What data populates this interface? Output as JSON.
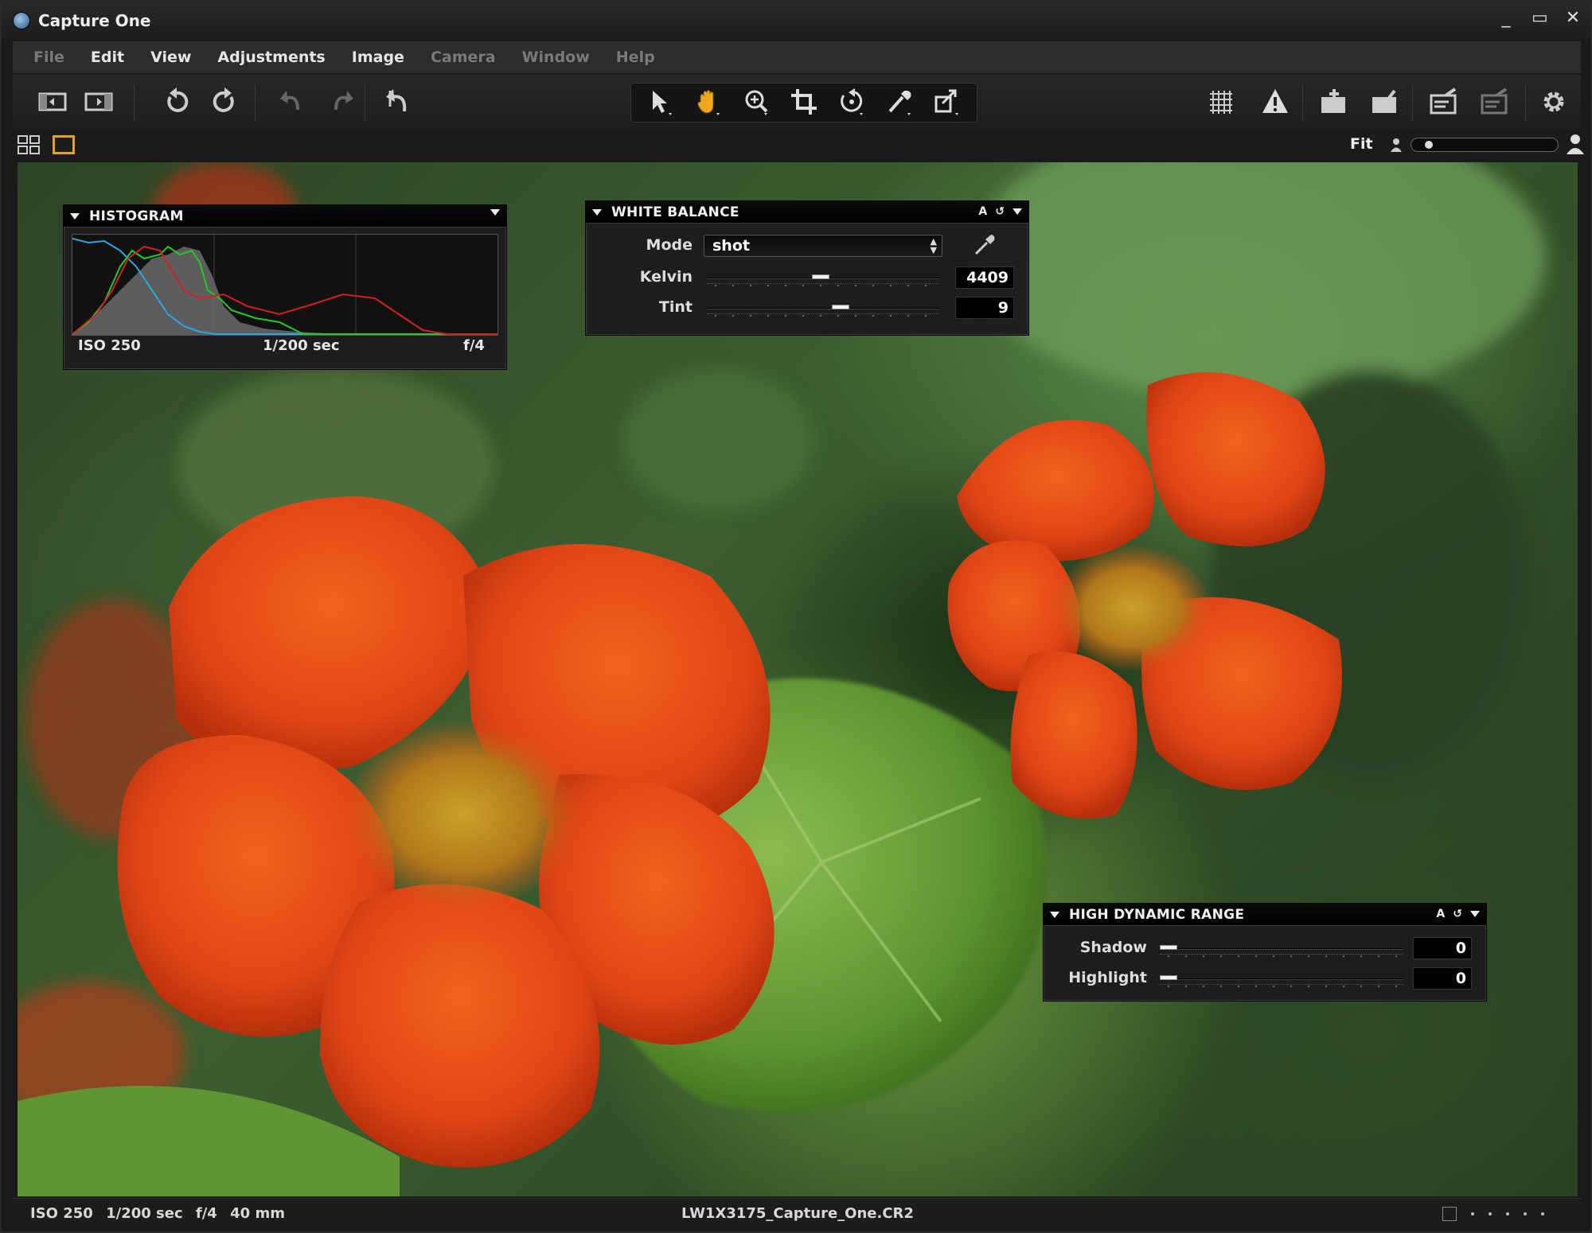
{
  "window": {
    "title": "Capture One",
    "controls": {
      "minimize": "_",
      "maximize": "▭",
      "close": "✕"
    }
  },
  "menu": [
    {
      "label": "File",
      "enabled": false
    },
    {
      "label": "Edit",
      "enabled": true
    },
    {
      "label": "View",
      "enabled": true
    },
    {
      "label": "Adjustments",
      "enabled": true
    },
    {
      "label": "Image",
      "enabled": true
    },
    {
      "label": "Camera",
      "enabled": false
    },
    {
      "label": "Window",
      "enabled": false
    },
    {
      "label": "Help",
      "enabled": false
    }
  ],
  "toolbar": {
    "icons": [
      "browser-toggle-icon",
      "viewer-toggle-icon",
      "rotate-left-icon",
      "rotate-right-icon",
      "undo-icon",
      "redo-icon",
      "reset-icon",
      "cursor-icon",
      "hand-icon",
      "zoom-icon",
      "crop-icon",
      "straighten-icon",
      "color-picker-icon",
      "spot-icon",
      "grid-icon",
      "exposure-warning-icon",
      "add-capture-icon",
      "output-icon",
      "process-icon",
      "batch-icon",
      "settings-icon"
    ],
    "active_tool": "hand-icon"
  },
  "viewer_header": {
    "zoom_label": "Fit",
    "zoom_level": 0.1
  },
  "histogram": {
    "title": "HISTOGRAM",
    "iso": "ISO 250",
    "shutter": "1/200 sec",
    "aperture": "f/4"
  },
  "white_balance": {
    "title": "WHITE BALANCE",
    "auto_label": "A",
    "mode_label": "Mode",
    "mode_value": "shot",
    "kelvin_label": "Kelvin",
    "kelvin_value": "4409",
    "kelvin_slider": 0.49,
    "tint_label": "Tint",
    "tint_value": "9",
    "tint_slider": 0.58
  },
  "hdr": {
    "title": "HIGH DYNAMIC RANGE",
    "auto_label": "A",
    "shadow_label": "Shadow",
    "shadow_value": "0",
    "shadow_slider": 0.0,
    "highlight_label": "Highlight",
    "highlight_value": "0",
    "highlight_slider": 0.0
  },
  "status": {
    "iso": "ISO 250",
    "shutter": "1/200 sec",
    "aperture": "f/4",
    "focal": "40 mm",
    "filename": "LW1X3175_Capture_One.CR2"
  },
  "colors": {
    "accent": "#e7a122",
    "histogram_red": "#d42020",
    "histogram_green": "#22cc22",
    "histogram_blue": "#2aa8e8",
    "flower_orange": "#e5491a"
  }
}
